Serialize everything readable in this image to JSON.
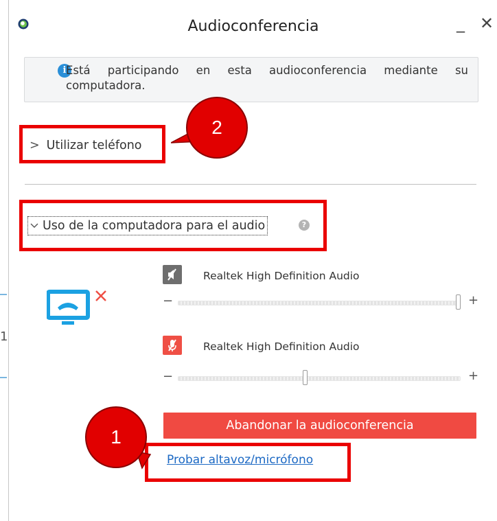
{
  "window": {
    "title": "Audioconferencia",
    "minimize_glyph": "_",
    "close_glyph": "✕"
  },
  "left_edge_char": "1",
  "info": {
    "icon_glyph": "i",
    "text": "Está participando en esta audioconferencia mediante su computadora."
  },
  "phone_section": {
    "chevron": ">",
    "label": "Utilizar teléfono"
  },
  "computer_section": {
    "chevron": "v",
    "label": "Uso de la computadora para el audio",
    "help_glyph": "?"
  },
  "devices": {
    "speaker": {
      "icon": "speaker-muted-icon",
      "label": "Realtek High Definition Audio",
      "level_percent": 100
    },
    "microphone": {
      "icon": "microphone-muted-icon",
      "label": "Realtek High Definition Audio",
      "level_percent": 45
    },
    "minus_glyph": "−",
    "plus_glyph": "+"
  },
  "actions": {
    "leave_label": "Abandonar la audioconferencia",
    "test_link_label": "Probar altavoz/micrófono"
  },
  "annotations": {
    "callout_1": "1",
    "callout_2": "2"
  },
  "colors": {
    "accent_red": "#f04a42",
    "info_blue": "#2a8fd8",
    "link_blue": "#1c69c4",
    "highlight_red": "#ea0000",
    "pc_icon_blue": "#1ba1e2"
  }
}
